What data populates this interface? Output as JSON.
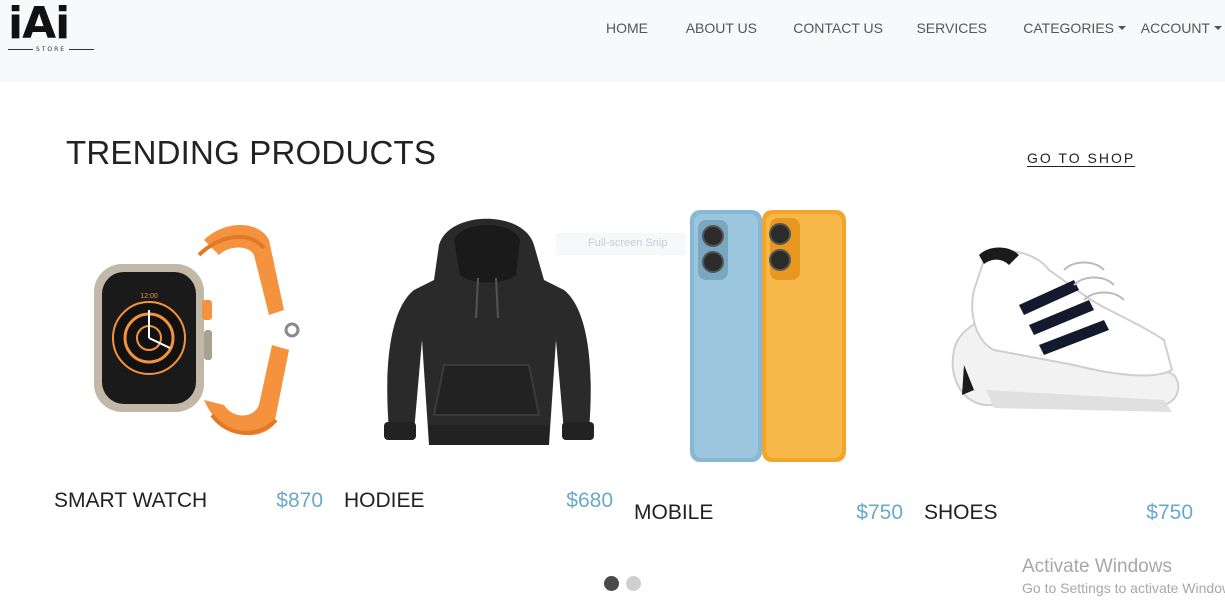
{
  "brand": {
    "logo_text": "iAi",
    "logo_sub": "STORE"
  },
  "nav": {
    "items": [
      {
        "label": "HOME",
        "dropdown": false
      },
      {
        "label": "ABOUT US",
        "dropdown": false
      },
      {
        "label": "CONTACT US",
        "dropdown": false
      },
      {
        "label": "SERVICES",
        "dropdown": false
      },
      {
        "label": "CATEGORIES",
        "dropdown": true
      },
      {
        "label": "ACCOUNT",
        "dropdown": true
      }
    ]
  },
  "section": {
    "title": "TRENDING PRODUCTS",
    "shop_link": "GO TO SHOP"
  },
  "products": [
    {
      "name": "SMART WATCH",
      "price": "$870",
      "icon": "smartwatch-image"
    },
    {
      "name": "HODIEE",
      "price": "$680",
      "icon": "hoodie-image"
    },
    {
      "name": "MOBILE",
      "price": "$750",
      "icon": "mobile-phone-image"
    },
    {
      "name": "SHOES",
      "price": "$750",
      "icon": "sneakers-image"
    }
  ],
  "tooltip": {
    "text": "Full-screen Snip"
  },
  "carousel": {
    "pages": 2,
    "active": 1
  },
  "watermark": {
    "title": "Activate Windows",
    "subtitle": "Go to Settings to activate Windows."
  },
  "colors": {
    "price": "#6aa9c9",
    "navbar_bg": "#f8f9fa",
    "watch_band": "#f5923e",
    "phone_blue": "#8ab8d4",
    "phone_orange": "#f3a52b"
  }
}
